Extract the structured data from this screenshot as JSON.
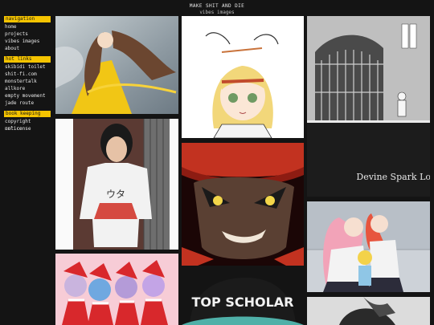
{
  "site": {
    "title": "MAKE SHIT AND DIE",
    "subtitle": "vibes images"
  },
  "sidebar": {
    "sections": [
      {
        "heading": "navigation",
        "items": [
          "home",
          "projects",
          "vibes images",
          "about"
        ]
      },
      {
        "heading": "hot links",
        "items": [
          "skibidi toilet",
          "shit-fi.com",
          "monstertalk",
          "allkore",
          "empty movement",
          "jade route"
        ]
      },
      {
        "heading": "book keeping",
        "items": [
          "copyright notice",
          "unlicense"
        ]
      }
    ]
  },
  "gallery": {
    "manga_caption": "Devine Spark Lost...",
    "cap_text": "TOP SCHOLAR",
    "shirt_text": "ウタ"
  },
  "colors": {
    "accent": "#f5c400",
    "background": "#141414",
    "text": "#e8e8e8"
  }
}
